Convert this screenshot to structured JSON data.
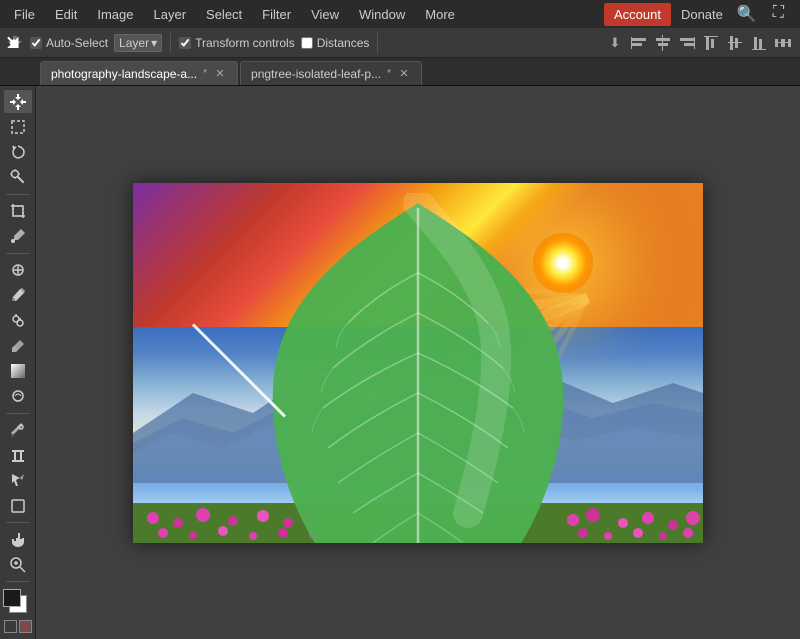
{
  "menubar": {
    "items": [
      "File",
      "Edit",
      "Image",
      "Layer",
      "Select",
      "Filter",
      "View",
      "Window",
      "More"
    ],
    "account_label": "Account",
    "donate_label": "Donate"
  },
  "toolbar": {
    "auto_select_label": "Auto-Select",
    "layer_dropdown": "Layer",
    "transform_controls_label": "Transform controls",
    "distances_label": "Distances",
    "transform_checked": true,
    "distances_checked": false,
    "auto_select_checked": true
  },
  "tabs": [
    {
      "label": "photography-landscape-a...",
      "active": true,
      "modified": true
    },
    {
      "label": "pngtree-isolated-leaf-p...",
      "active": false,
      "modified": true
    }
  ],
  "tools": [
    {
      "name": "move-tool",
      "icon": "↖",
      "active": true
    },
    {
      "name": "marquee-tool",
      "icon": "⬚"
    },
    {
      "name": "lasso-tool",
      "icon": "⌒"
    },
    {
      "name": "magic-wand-tool",
      "icon": "✦"
    },
    {
      "name": "crop-tool",
      "icon": "⊹"
    },
    {
      "name": "eyedropper-tool",
      "icon": "⊿"
    },
    {
      "name": "heal-tool",
      "icon": "✚"
    },
    {
      "name": "brush-tool",
      "icon": "🖌"
    },
    {
      "name": "clone-tool",
      "icon": "⊕"
    },
    {
      "name": "eraser-tool",
      "icon": "◻"
    },
    {
      "name": "gradient-tool",
      "icon": "◑"
    },
    {
      "name": "dodge-tool",
      "icon": "◯"
    },
    {
      "name": "pen-tool",
      "icon": "✒"
    },
    {
      "name": "type-tool",
      "icon": "T"
    },
    {
      "name": "path-tool",
      "icon": "⊻"
    },
    {
      "name": "shape-tool",
      "icon": "↔"
    },
    {
      "name": "hand-tool",
      "icon": "✋"
    },
    {
      "name": "zoom-tool",
      "icon": "⊕"
    }
  ]
}
